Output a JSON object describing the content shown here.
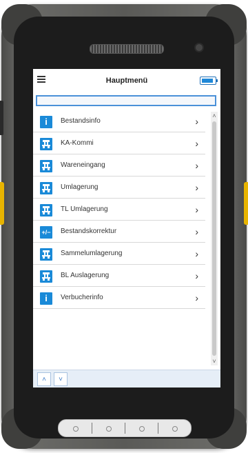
{
  "header": {
    "title": "Hauptmenü"
  },
  "search": {
    "value": ""
  },
  "menu": {
    "items": [
      {
        "label": "Bestandsinfo",
        "icon": "info-icon"
      },
      {
        "label": "KA-Kommi",
        "icon": "transfer-icon"
      },
      {
        "label": "Wareneingang",
        "icon": "transfer-icon"
      },
      {
        "label": "Umlagerung",
        "icon": "transfer-icon"
      },
      {
        "label": "TL Umlagerung",
        "icon": "transfer-icon"
      },
      {
        "label": "Bestandskorrektur",
        "icon": "plus-minus-icon"
      },
      {
        "label": "Sammelumlagerung",
        "icon": "transfer-icon"
      },
      {
        "label": "BL Auslagerung",
        "icon": "transfer-icon"
      },
      {
        "label": "Verbucherinfo",
        "icon": "info-icon"
      }
    ]
  },
  "glyphs": {
    "chevron": "›",
    "info": "i",
    "plusminus": "+/−",
    "scroll_up": "˄",
    "scroll_down": "˅",
    "page_up": "˄",
    "page_down": "˅"
  },
  "colors": {
    "accent": "#1a8ad8",
    "device": "#5a5a57",
    "side_keys": "#e8b400"
  }
}
